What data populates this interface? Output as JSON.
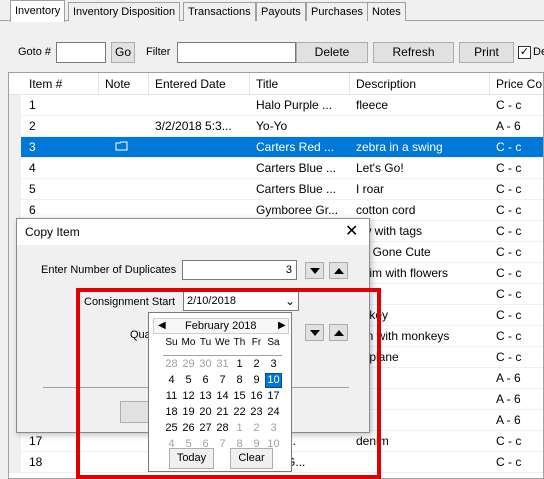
{
  "tabs": [
    "Inventory",
    "Inventory Disposition",
    "Transactions",
    "Payouts",
    "Purchases",
    "Notes"
  ],
  "toolbar": {
    "goto_label": "Goto #",
    "goto_value": "",
    "go_label": "Go",
    "filter_label": "Filter",
    "filter_value": "",
    "delete_label": "Delete",
    "refresh_label": "Refresh",
    "print_label": "Print",
    "checkbox_label": "De",
    "checkbox_checked": true
  },
  "grid": {
    "columns": [
      "Item #",
      "Note",
      "Entered Date",
      "Title",
      "Description",
      "Price Co"
    ],
    "rows": [
      {
        "item": "1",
        "note": "",
        "date": "",
        "title": "Halo Purple ...",
        "desc": "fleece",
        "price": "C - c"
      },
      {
        "item": "2",
        "note": "",
        "date": "3/2/2018 5:3...",
        "title": "Yo-Yo",
        "desc": "",
        "price": "A - 6"
      },
      {
        "item": "3",
        "note": "folder",
        "date": "",
        "title": "Carters Red ...",
        "desc": "zebra in a swing",
        "price": "C - c",
        "selected": true
      },
      {
        "item": "4",
        "note": "",
        "date": "",
        "title": "Carters Blue ...",
        "desc": "Let's Go!",
        "price": "C - c"
      },
      {
        "item": "5",
        "note": "",
        "date": "",
        "title": "Carters Blue ...",
        "desc": "I roar",
        "price": "C - c"
      },
      {
        "item": "6",
        "note": "",
        "date": "",
        "title": "Gymboree Gr...",
        "desc": "cotton cord",
        "price": "C - c"
      },
      {
        "item": "",
        "note": "",
        "date": "",
        "title": "",
        "desc": "ew with tags",
        "price": "C - c"
      },
      {
        "item": "",
        "note": "",
        "date": "",
        "title": "",
        "desc": "og Gone Cute",
        "price": "C - c"
      },
      {
        "item": "",
        "note": "",
        "date": "",
        "title": "",
        "desc": "enim with flowers",
        "price": "C - c"
      },
      {
        "item": "",
        "note": "",
        "date": "",
        "title": "",
        "desc": "",
        "price": "C - c"
      },
      {
        "item": "",
        "note": "",
        "date": "",
        "title": "",
        "desc": "onkey",
        "price": "C - c"
      },
      {
        "item": "",
        "note": "",
        "date": "",
        "title": "",
        "desc": "ren with monkeys",
        "price": "C - c"
      },
      {
        "item": "",
        "note": "",
        "date": "",
        "title": "",
        "desc": "airplane",
        "price": "C - c"
      },
      {
        "item": "",
        "note": "",
        "date": "",
        "title": "",
        "desc": "",
        "price": "A - 6"
      },
      {
        "item": "",
        "note": "",
        "date": "",
        "title": "",
        "desc": "",
        "price": "A - 6"
      },
      {
        "item": "",
        "note": "",
        "date": "",
        "title": "",
        "desc": "",
        "price": "A - 6"
      },
      {
        "item": "17",
        "note": "",
        "date": "",
        "title": "lue Si...",
        "desc": "denim",
        "price": "C - c"
      },
      {
        "item": "18",
        "note": "",
        "date": "",
        "title": "oden G...",
        "desc": "",
        "price": "C - c"
      }
    ]
  },
  "dialog": {
    "title": "Copy Item",
    "dup_label": "Enter Number of Duplicates",
    "dup_value": "3",
    "consign_label": "Consignment Start",
    "consign_value": "2/10/2018",
    "qty_label_partial": "Qua"
  },
  "calendar": {
    "month_label": "February 2018",
    "weekdays": [
      "Su",
      "Mo",
      "Tu",
      "We",
      "Th",
      "Fr",
      "Sa"
    ],
    "weeks": [
      [
        "28",
        "29",
        "30",
        "31",
        "1",
        "2",
        "3"
      ],
      [
        "4",
        "5",
        "6",
        "7",
        "8",
        "9",
        "10"
      ],
      [
        "11",
        "12",
        "13",
        "14",
        "15",
        "16",
        "17"
      ],
      [
        "18",
        "19",
        "20",
        "21",
        "22",
        "23",
        "24"
      ],
      [
        "25",
        "26",
        "27",
        "28",
        "1",
        "2",
        "3"
      ],
      [
        "4",
        "5",
        "6",
        "7",
        "8",
        "9",
        "10"
      ]
    ],
    "selected_day": "10",
    "today_label": "Today",
    "clear_label": "Clear"
  },
  "colors": {
    "selection": "#0078d7",
    "highlight": "#e00000"
  }
}
